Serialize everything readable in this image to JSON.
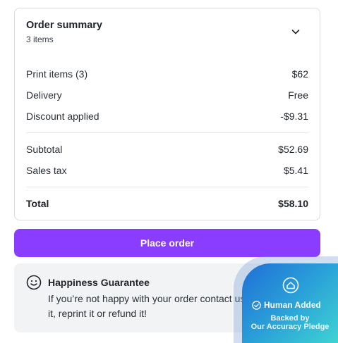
{
  "summary": {
    "title": "Order summary",
    "item_count": "3 items",
    "rows": [
      {
        "label": "Print items (3)",
        "value": "$62"
      },
      {
        "label": "Delivery",
        "value": "Free"
      },
      {
        "label": "Discount applied",
        "value": "-$9.31"
      }
    ],
    "subtotal": {
      "label": "Subtotal",
      "value": "$52.69"
    },
    "tax": {
      "label": "Sales tax",
      "value": "$5.41"
    },
    "total": {
      "label": "Total",
      "value": "$58.10"
    }
  },
  "place_order_label": "Place order",
  "guarantee": {
    "title": "Happiness Guarantee",
    "text": "If you’re not happy with your order contact us and we’ll fix it, reprint it or refund it!"
  },
  "badge": {
    "title": "Human Added",
    "line1": "Backed by",
    "line2": "Our Accuracy Pledge"
  },
  "colors": {
    "accent": "#8b3dff",
    "badge_start": "#1f6fd6",
    "badge_end": "#3fd3d3"
  }
}
